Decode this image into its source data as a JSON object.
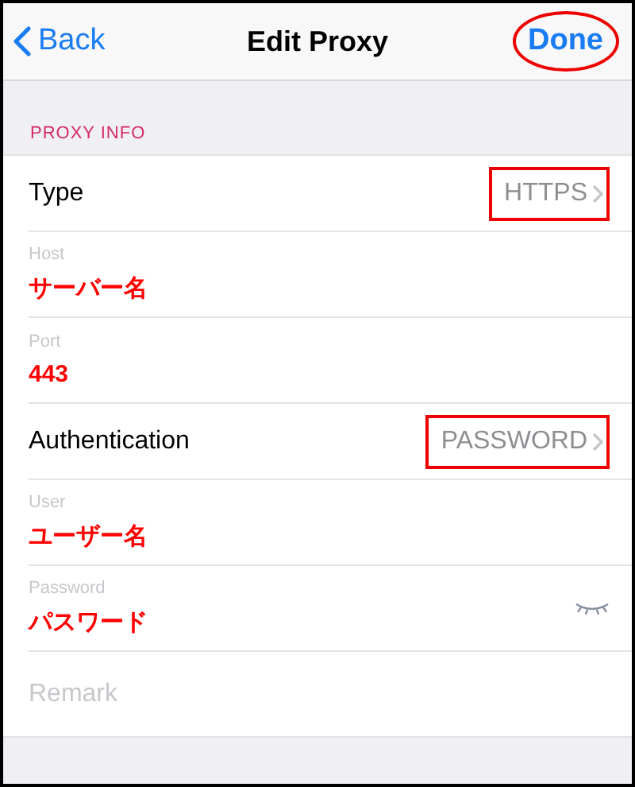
{
  "nav": {
    "back_label": "Back",
    "title": "Edit Proxy",
    "done": {
      "label": "Done",
      "annotated": true
    }
  },
  "section_header": "PROXY INFO",
  "rows": [
    {
      "kind": "select",
      "label": "Type",
      "value": "HTTPS",
      "annotated": true
    },
    {
      "kind": "field",
      "label": "Host",
      "value": "サーバー名"
    },
    {
      "kind": "field",
      "label": "Port",
      "value": "443"
    },
    {
      "kind": "select",
      "label": "Authentication",
      "value": "PASSWORD",
      "annotated": true
    },
    {
      "kind": "field",
      "label": "User",
      "value": "ユーザー名"
    },
    {
      "kind": "password",
      "label": "Password",
      "value": "パスワード"
    },
    {
      "kind": "input",
      "placeholder": "Remark"
    }
  ]
}
